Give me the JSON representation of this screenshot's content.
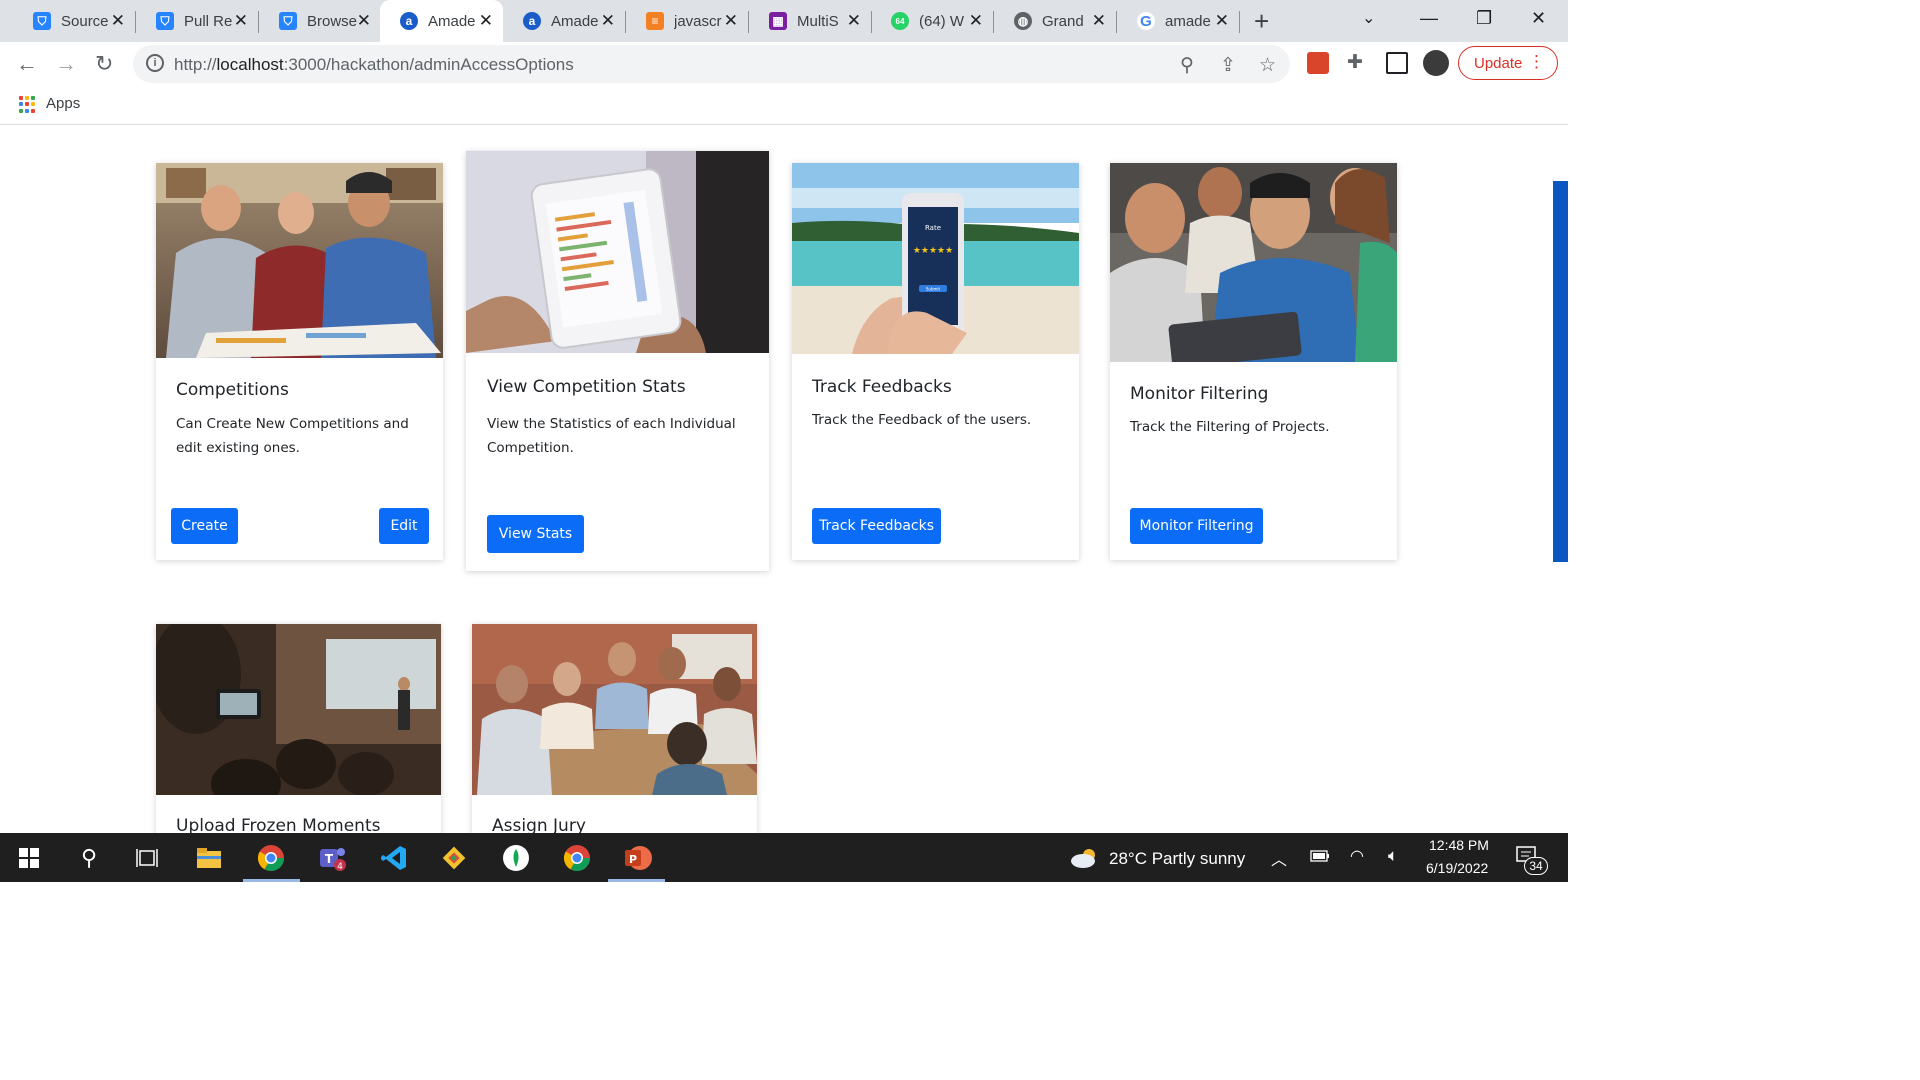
{
  "browser": {
    "tabs": [
      {
        "title": "Source",
        "favicon": "bitbucket-icon",
        "color": "#2684ff",
        "glyph": "⛉"
      },
      {
        "title": "Pull Re",
        "favicon": "bitbucket-icon",
        "color": "#2684ff",
        "glyph": "⛉"
      },
      {
        "title": "Browse",
        "favicon": "bitbucket-icon",
        "color": "#2684ff",
        "glyph": "⛉"
      },
      {
        "title": "Amade",
        "favicon": "amadeus-icon",
        "color": "#1a5dc9",
        "glyph": "a"
      },
      {
        "title": "Amade",
        "favicon": "amadeus-icon",
        "color": "#1a5dc9",
        "glyph": "a"
      },
      {
        "title": "javascr",
        "favicon": "stackoverflow-icon",
        "color": "#f48024",
        "glyph": "≡"
      },
      {
        "title": "MultiS",
        "favicon": "microsoft-icon",
        "color": "#7a1fa2",
        "glyph": "▦"
      },
      {
        "title": "(64) W",
        "favicon": "whatsapp-icon",
        "color": "#25d366",
        "glyph": "64"
      },
      {
        "title": "Grand",
        "favicon": "globe-icon",
        "color": "#5f6368",
        "glyph": "◍"
      },
      {
        "title": "amade",
        "favicon": "google-icon",
        "color": "#4285f4",
        "glyph": "G"
      }
    ],
    "active_tab_index": 3,
    "url_prefix": "http://",
    "url_host": "localhost",
    "url_rest": ":3000/hackathon/adminAccessOptions",
    "update_label": "Update",
    "bookmarks_apps_label": "Apps"
  },
  "cards": [
    {
      "title": "Competitions",
      "text": "Can Create New Competitions and edit existing ones.",
      "buttons": [
        "Create",
        "Edit"
      ],
      "image": "team-brainstorming-photo"
    },
    {
      "title": "View Competition Stats",
      "text": "View the Statistics of each Individual Competition.",
      "buttons": [
        "View Stats"
      ],
      "image": "tablet-statistics-photo"
    },
    {
      "title": "Track Feedbacks",
      "text": "Track the Feedback of the users.",
      "buttons": [
        "Track Feedbacks"
      ],
      "image": "phone-rating-beach-photo",
      "phone_text": "Rate",
      "phone_button": "Submit"
    },
    {
      "title": "Monitor Filtering",
      "text": "Track the Filtering of Projects.",
      "buttons": [
        "Monitor Filtering"
      ],
      "image": "group-looking-at-tablet-photo"
    },
    {
      "title": "Upload Frozen Moments",
      "text": "",
      "buttons": [],
      "image": "presentation-audience-photo"
    },
    {
      "title": "Assign Jury",
      "text": "",
      "buttons": [],
      "image": "team-meeting-table-photo"
    }
  ],
  "taskbar": {
    "weather": "28°C  Partly sunny",
    "time": "12:48 PM",
    "date": "6/19/2022",
    "notifications": "34",
    "teams_badge": "4"
  },
  "colors": {
    "primary_button": "#0a6cf7",
    "update_red": "#d93025",
    "taskbar": "#1f1f20"
  }
}
